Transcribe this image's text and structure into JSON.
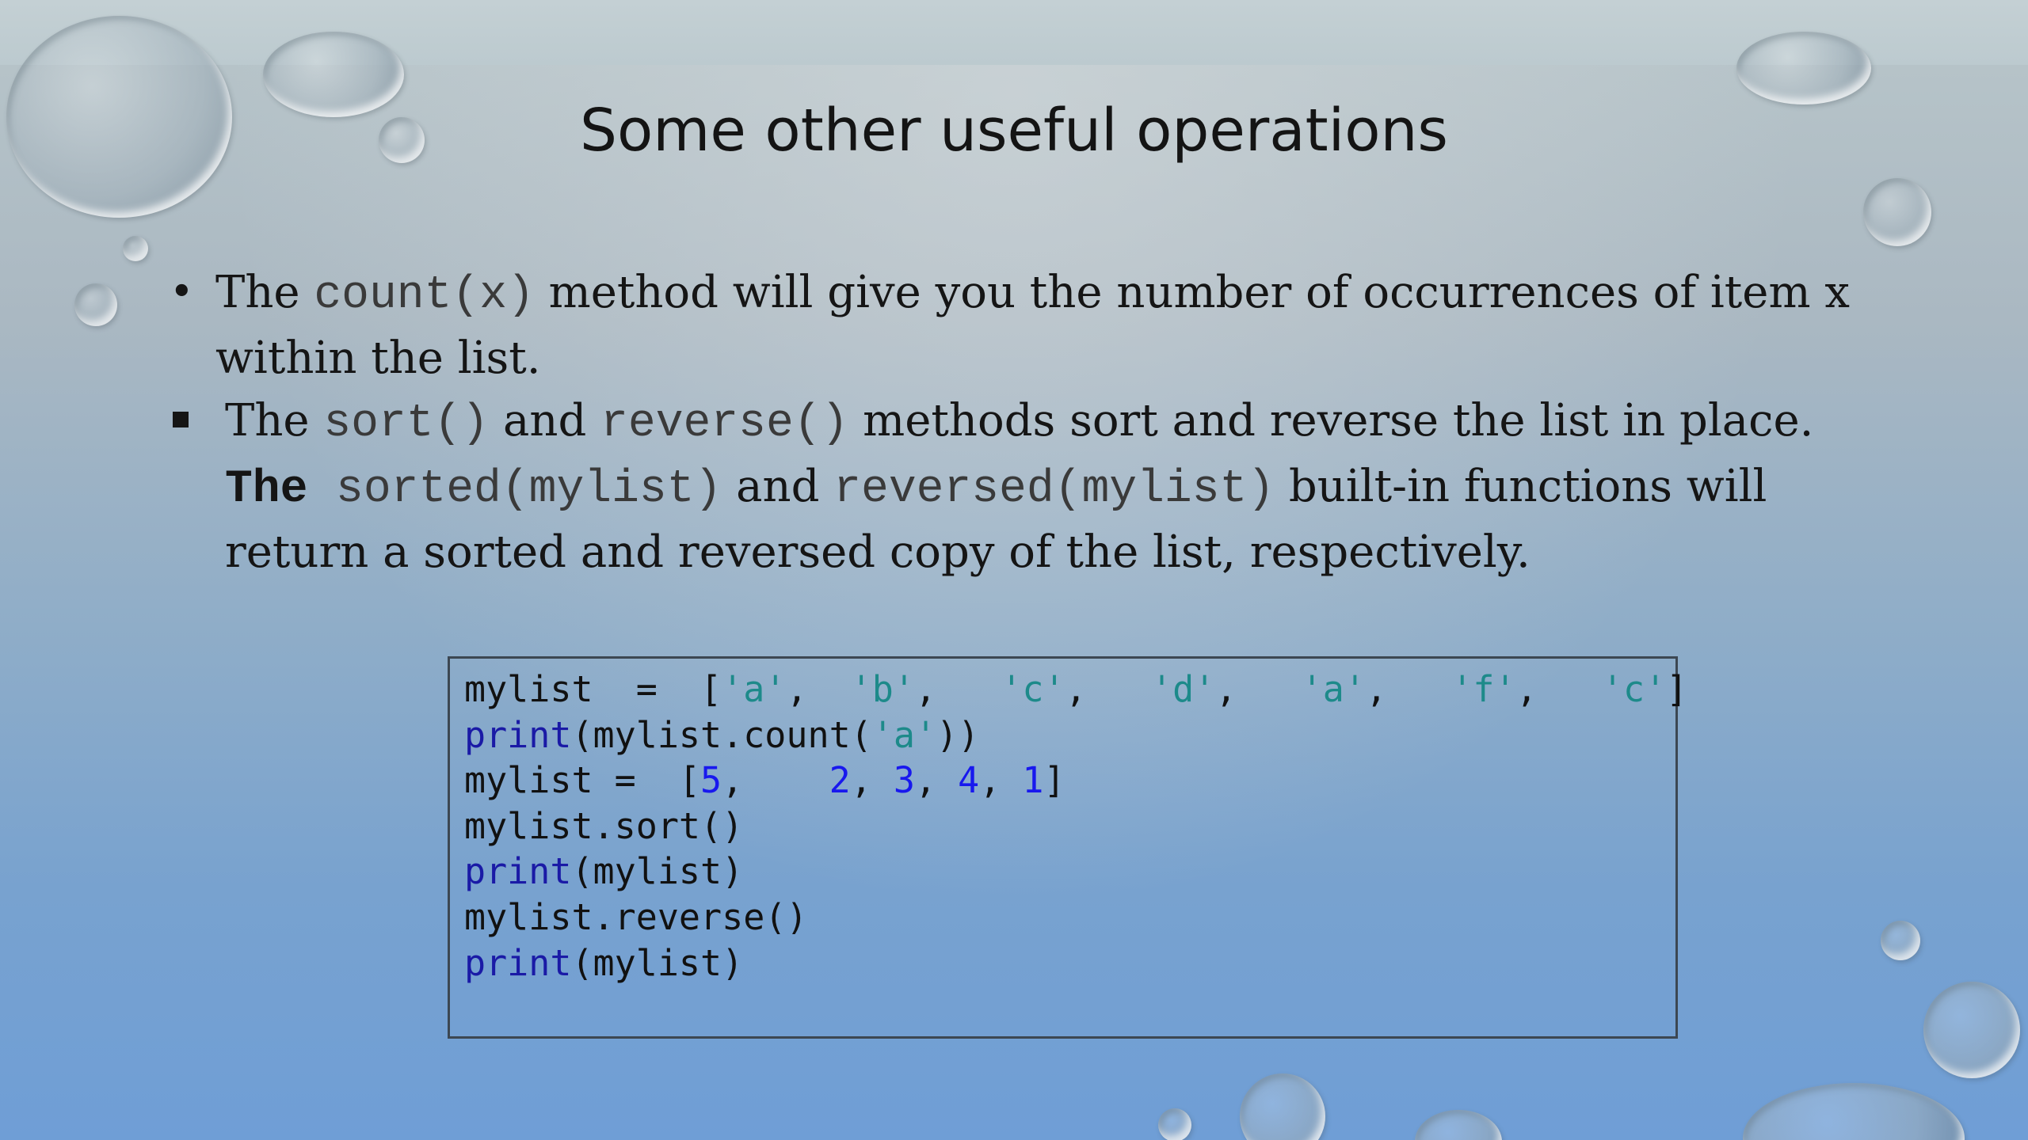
{
  "slide": {
    "title": "Some other useful operations",
    "bullet1": {
      "t1": "The ",
      "c1": "count(x)",
      "t2": " method will give you the number of occurrences of item x within the list."
    },
    "bullet2": {
      "t1": "The ",
      "c1": "sort()",
      "t2": " and ",
      "c2": "reverse()",
      "t3": " methods sort and reverse the list in place.",
      "t4": "The",
      "c3": "sorted(mylist)",
      "t5": " and ",
      "c4": "reversed(mylist)",
      "t6": " built-in functions will return a sorted and reversed copy of the list, respectively."
    }
  },
  "code": {
    "line1": {
      "a": "mylist  =  [",
      "s1": "'a'",
      "p1": ",  ",
      "s2": "'b'",
      "p2": ",   ",
      "s3": "'c'",
      "p3": ",   ",
      "s4": "'d'",
      "p4": ",   ",
      "s5": "'a'",
      "p5": ",   ",
      "s6": "'f'",
      "p6": ",   ",
      "s7": "'c'",
      "p7": "]"
    },
    "line2": {
      "kw": "print",
      "a": "(mylist.count(",
      "s": "'a'",
      "b": "))"
    },
    "line3": {
      "a": "mylist =  [",
      "n1": "5",
      "p1": ",    ",
      "n2": "2",
      "p2": ", ",
      "n3": "3",
      "p3": ", ",
      "n4": "4",
      "p4": ", ",
      "n5": "1",
      "p5": "]"
    },
    "line4": "mylist.sort()",
    "line5": {
      "kw": "print",
      "a": "(mylist)"
    },
    "line6": "mylist.reverse()",
    "line7": {
      "kw": "print",
      "a": "(mylist)"
    }
  }
}
